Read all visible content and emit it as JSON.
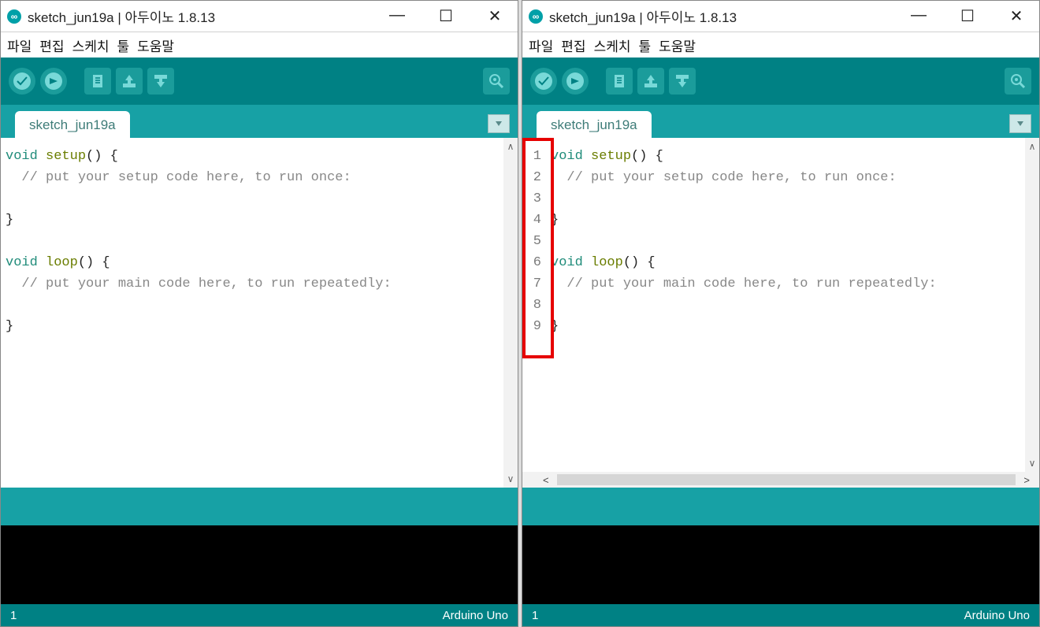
{
  "title_text": "sketch_jun19a | 아두이노 1.8.13",
  "menu": [
    "파일",
    "편집",
    "스케치",
    "툴",
    "도움말"
  ],
  "tab_name": "sketch_jun19a",
  "toolbar_icons": [
    "verify",
    "upload",
    "new",
    "open",
    "save",
    "serial"
  ],
  "code_lines": [
    {
      "type": "code",
      "kw": "void",
      "fn": "setup",
      "tail": "() {"
    },
    {
      "type": "comment",
      "text": "  // put your setup code here, to run once:"
    },
    {
      "type": "blank",
      "text": ""
    },
    {
      "type": "punc",
      "text": "}"
    },
    {
      "type": "blank",
      "text": ""
    },
    {
      "type": "code",
      "kw": "void",
      "fn": "loop",
      "tail": "() {"
    },
    {
      "type": "comment",
      "text": "  // put your main code here, to run repeatedly:"
    },
    {
      "type": "blank",
      "text": ""
    },
    {
      "type": "punc",
      "text": "}"
    }
  ],
  "line_numbers": [
    "1",
    "2",
    "3",
    "4",
    "5",
    "6",
    "7",
    "8",
    "9"
  ],
  "status_left": "1",
  "status_right": "Arduino Uno",
  "windows": [
    {
      "show_line_numbers": false,
      "show_hscroll": false,
      "highlight_gutter": false
    },
    {
      "show_line_numbers": true,
      "show_hscroll": true,
      "highlight_gutter": true
    }
  ]
}
